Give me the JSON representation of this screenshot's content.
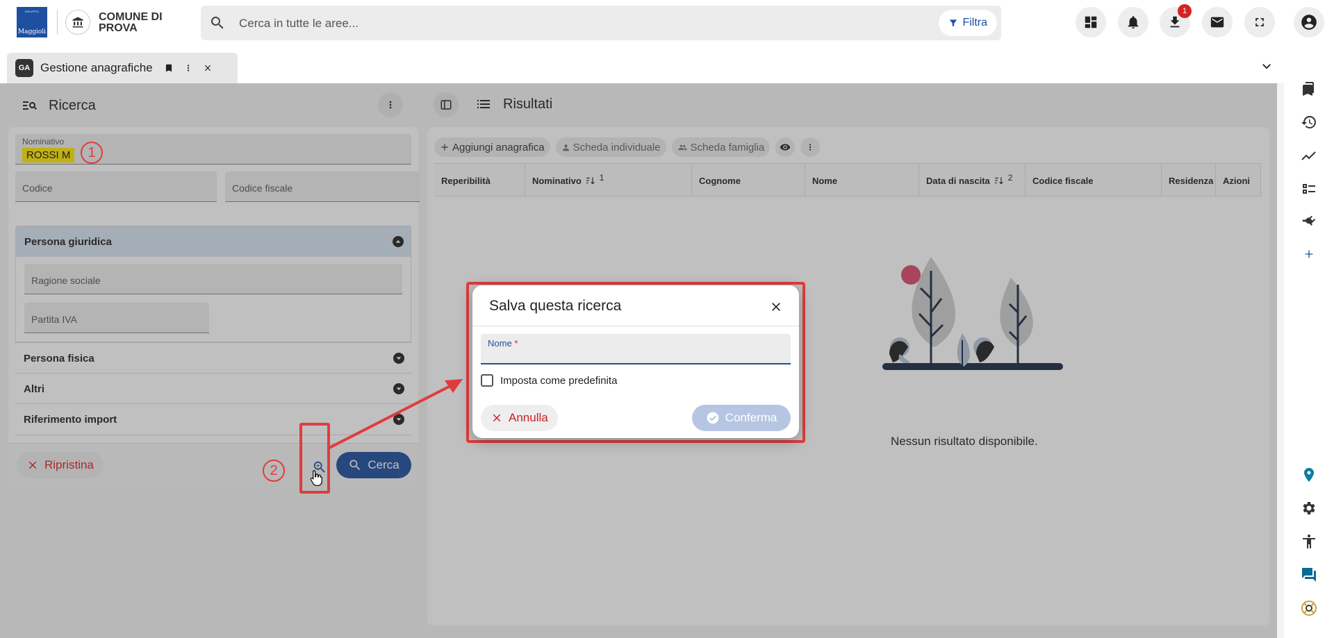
{
  "app": {
    "logo_top": "GRUPPO",
    "logo_brand": "Maggioli",
    "municipality": "COMUNE DI PROVA"
  },
  "search": {
    "placeholder": "Cerca in tutte le aree...",
    "filter_label": "Filtra"
  },
  "topbar": {
    "download_badge": "1"
  },
  "tab": {
    "logo_text": "GA",
    "title": "Gestione anagrafiche"
  },
  "left_panel": {
    "title": "Ricerca",
    "nominativo_label": "Nominativo",
    "nominativo_value": "ROSSI M",
    "codice_label": "Codice",
    "codice_fiscale_label": "Codice fiscale",
    "sections": [
      {
        "label": "Persona giuridica",
        "expanded": true
      },
      {
        "label": "Persona fisica",
        "expanded": false
      },
      {
        "label": "Altri",
        "expanded": false
      },
      {
        "label": "Riferimento import",
        "expanded": false
      }
    ],
    "ragione_sociale_label": "Ragione sociale",
    "partita_iva_label": "Partita IVA",
    "reset_label": "Ripristina",
    "search_label": "Cerca"
  },
  "annotations": {
    "step1": "1",
    "step2": "2"
  },
  "right_panel": {
    "title": "Risultati",
    "toolbar": {
      "add": "Aggiungi anagrafica",
      "individual": "Scheda individuale",
      "family": "Scheda famiglia"
    },
    "columns": [
      {
        "label": "Reperibilità",
        "sort": ""
      },
      {
        "label": "Nominativo",
        "sort": "1"
      },
      {
        "label": "Cognome",
        "sort": ""
      },
      {
        "label": "Nome",
        "sort": ""
      },
      {
        "label": "Data di nascita",
        "sort": "2"
      },
      {
        "label": "Codice fiscale",
        "sort": ""
      },
      {
        "label": "Residenza",
        "sort": ""
      },
      {
        "label": "Azioni",
        "sort": ""
      }
    ],
    "empty_message": "Nessun risultato disponibile."
  },
  "dialog": {
    "title": "Salva questa ricerca",
    "name_label": "Nome",
    "required_mark": "*",
    "default_label": "Imposta come predefinita",
    "default_checked": false,
    "cancel_label": "Annulla",
    "confirm_label": "Conferma"
  },
  "colors": {
    "brand": "#1e4fa0",
    "danger": "#d22222",
    "annotation": "#e03c3c",
    "highlight": "#ffe800"
  }
}
